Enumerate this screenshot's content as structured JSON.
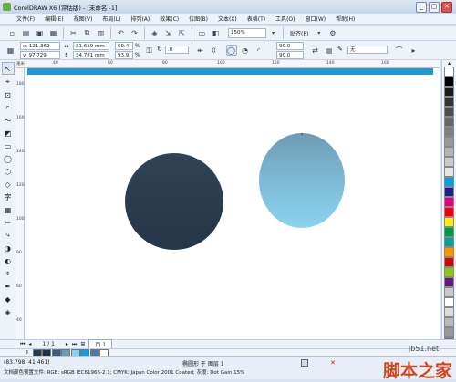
{
  "window": {
    "title": "CorelDRAW X6 (评估版) - [未命名 -1]",
    "min": "_",
    "max": "▢",
    "close": "✕"
  },
  "menu": [
    "文件(F)",
    "编辑(E)",
    "视图(V)",
    "布局(L)",
    "排列(A)",
    "效果(C)",
    "位图(B)",
    "文本(X)",
    "表格(T)",
    "工具(O)",
    "窗口(W)",
    "帮助(H)"
  ],
  "toolbar": {
    "zoom": "150%",
    "snap": "贴齐(P)"
  },
  "properties": {
    "x": "x: 121.369 mm",
    "y": "y: 97.729 mm",
    "w": "31.619 mm",
    "h": "34.781 mm",
    "scale_w": "50.4",
    "scale_h": "93.9",
    "pct": "%",
    "angle": ".0",
    "angle1": "90.0",
    "angle2": "90.0",
    "outline": "无"
  },
  "rulers": {
    "h_ticks": [
      "40",
      "60",
      "80",
      "100",
      "120",
      "140",
      "160"
    ],
    "h_unit": "毫米",
    "v_ticks": [
      "180",
      "160",
      "140",
      "120",
      "100",
      "80",
      "60",
      "40"
    ]
  },
  "pagenav": {
    "counter": "1 / 1",
    "tab": "页 1"
  },
  "status": {
    "coords": "(83.798, 41.461)",
    "object_info": "椭圆形 于 图层 1",
    "color_profile": "文档颜色预置文件: RGB: sRGB IEC61966-2.1; CMYK: Japan Color 2001 Coated; 灰度: Dot Gain 15%"
  },
  "watermark": {
    "site": "jb51.net",
    "text": "脚本之家"
  },
  "colors": {
    "accent": "#1a9ad6",
    "dark_ellipse": "#293a4d",
    "light_top": "#6e9bb4",
    "light_bottom": "#87d0ee"
  },
  "palette_colors": [
    "#ffffff",
    "#000000",
    "#1a1a1a",
    "#333333",
    "#4d4d4d",
    "#666666",
    "#808080",
    "#999999",
    "#b3b3b3",
    "#cccccc",
    "#e6e6e6",
    "#00a0e9",
    "#1d2088",
    "#e4007f",
    "#e60012",
    "#fff100",
    "#009944",
    "#00a29a",
    "#f39800",
    "#d7000f",
    "#8fc31f",
    "#601986",
    "#c9caca",
    "#ffffff",
    "#dddddd",
    "#bbbbbb",
    "#999999",
    "#777777",
    "#555555",
    "#333333"
  ],
  "doc_palette_colors": [
    "#2a3b4e",
    "#1d3147",
    "#3d5a78",
    "#6e9bb4",
    "#87d0ee",
    "#1a9ad6",
    "#4b79a0",
    "#ffffff"
  ]
}
